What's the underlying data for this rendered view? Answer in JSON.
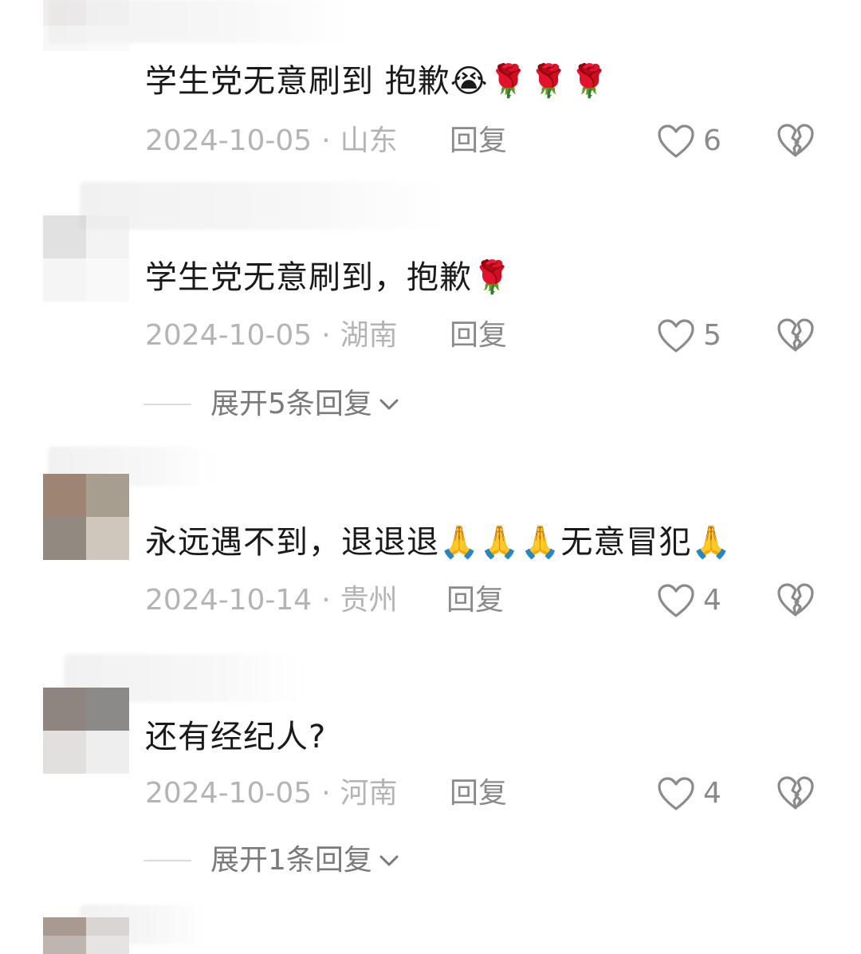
{
  "comments": [
    {
      "text": "学生党无意刷到 抱歉😭🌹🌹🌹",
      "date": "2024-10-05",
      "separator": "·",
      "location": "山东",
      "reply_label": "回复",
      "likes": "6"
    },
    {
      "text": "学生党无意刷到，抱歉🌹",
      "date": "2024-10-05",
      "separator": "·",
      "location": "湖南",
      "reply_label": "回复",
      "likes": "5",
      "expand_label": "展开5条回复"
    },
    {
      "text": "永远遇不到，退退退🙏🙏🙏无意冒犯🙏",
      "date": "2024-10-14",
      "separator": "·",
      "location": "贵州",
      "reply_label": "回复",
      "likes": "4"
    },
    {
      "text": "还有经纪人?",
      "date": "2024-10-05",
      "separator": "·",
      "location": "河南",
      "reply_label": "回复",
      "likes": "4",
      "expand_label": "展开1条回复"
    }
  ],
  "icons": {
    "like": "heart-outline-icon",
    "dislike": "broken-heart-icon",
    "expand": "chevron-down-icon"
  },
  "colors": {
    "text": "#1a1a1a",
    "meta": "#b4b4b4",
    "action": "#8a8a8a"
  }
}
